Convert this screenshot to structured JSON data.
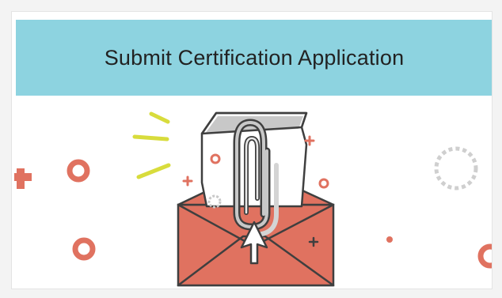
{
  "card": {
    "title": "Submit Certification Application",
    "illustration_icon": "envelope-paperclip-icon"
  },
  "colors": {
    "header_bg": "#8dd3e0",
    "accent_coral": "#e07260",
    "accent_yellow": "#d8dc3c",
    "outline": "#3f3f3f",
    "gray": "#c8c8c8"
  }
}
